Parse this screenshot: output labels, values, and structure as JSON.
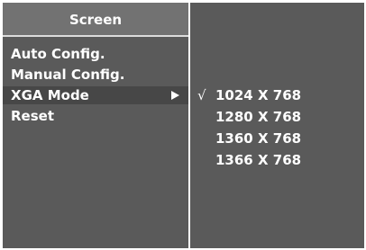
{
  "menu": {
    "title": "Screen",
    "items": [
      {
        "label": "Auto Config."
      },
      {
        "label": "Manual Config."
      },
      {
        "label": "XGA Mode"
      },
      {
        "label": "Reset"
      }
    ]
  },
  "submenu": {
    "check_glyph": "√",
    "options": [
      {
        "label": "1024 X 768",
        "checked": true
      },
      {
        "label": "1280 X 768",
        "checked": false
      },
      {
        "label": "1360 X 768",
        "checked": false
      },
      {
        "label": "1366 X 768",
        "checked": false
      }
    ]
  },
  "colors": {
    "panel_bg": "#5a5a5a",
    "title_bg": "#727272",
    "highlight_bg": "#474747",
    "text": "#ffffff"
  }
}
